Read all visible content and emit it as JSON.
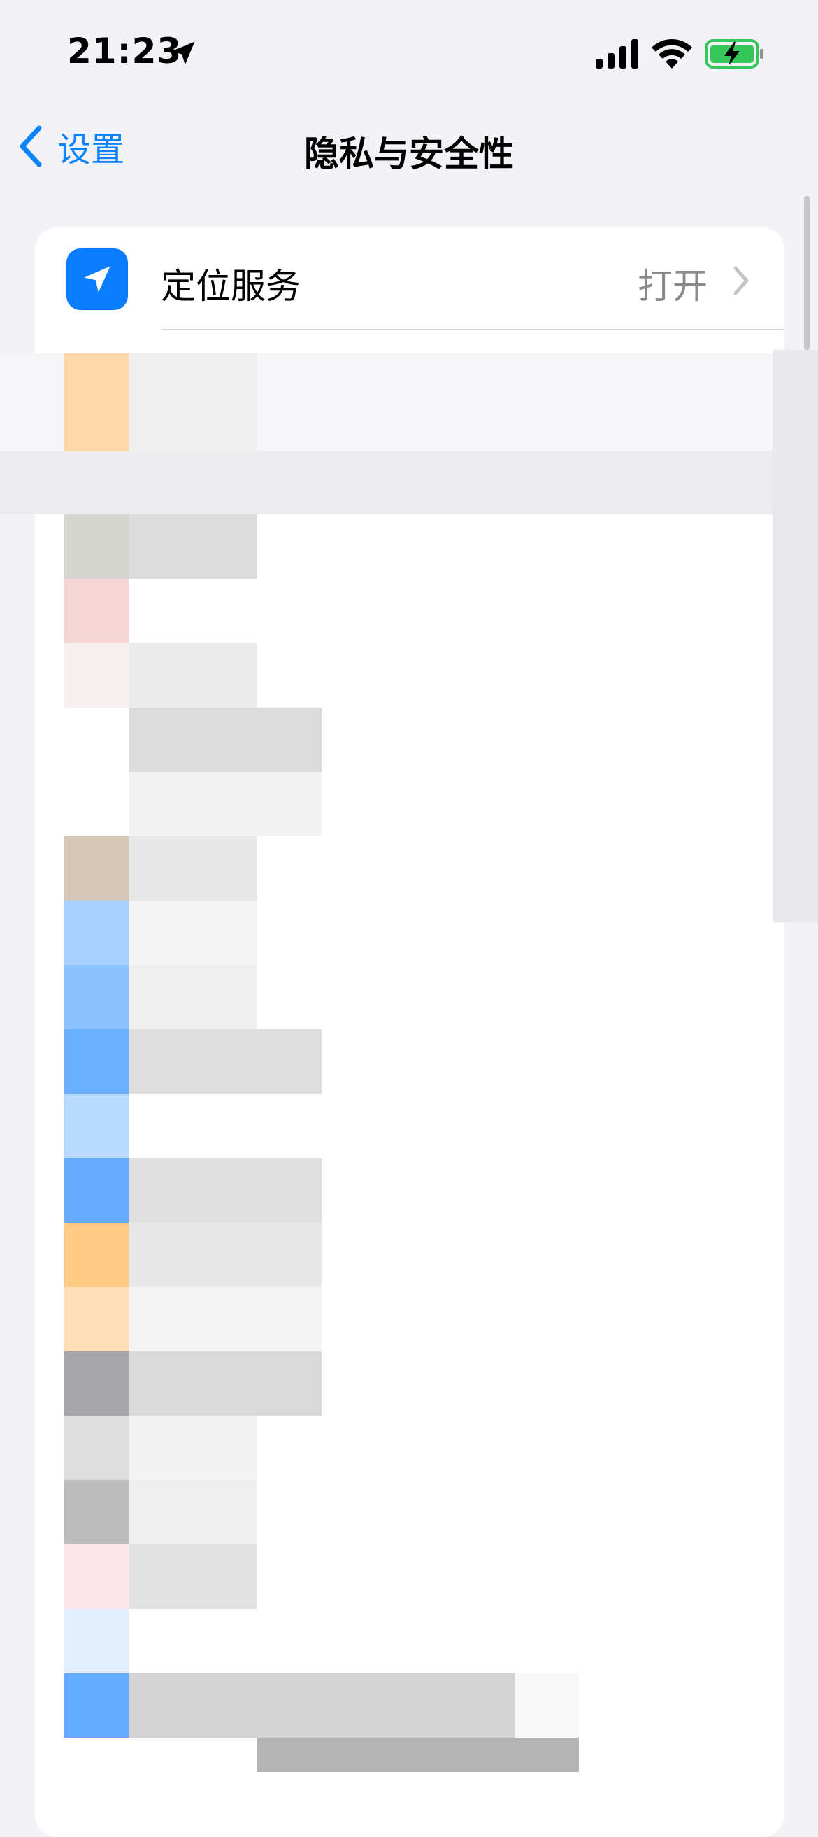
{
  "status_bar": {
    "time": "21:23",
    "icons": [
      "location-arrow-icon",
      "cellular-signal-icon",
      "wifi-icon",
      "battery-charging-icon"
    ]
  },
  "nav": {
    "back_label": "设置",
    "title": "隐私与安全性"
  },
  "rows": [
    {
      "label": "定位服务",
      "value": "打开",
      "icon": "location-arrow-icon",
      "icon_color": "#0a7cff"
    }
  ],
  "colors": {
    "accent": "#0a84ff",
    "background": "#f2f2f7",
    "secondary_text": "#8a8a8e"
  }
}
